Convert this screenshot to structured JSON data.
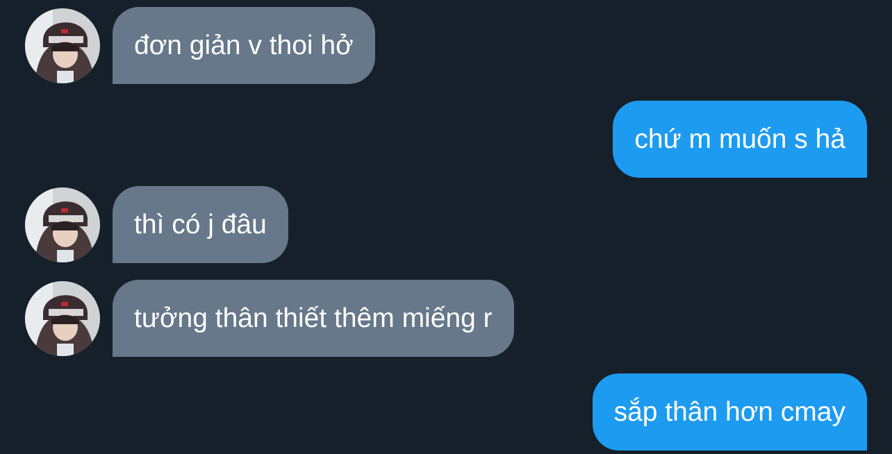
{
  "conversation": {
    "messages": [
      {
        "direction": "incoming",
        "text": "đơn giản v thoi hở",
        "avatar_icon": "user-avatar"
      },
      {
        "direction": "outgoing",
        "text": "chứ m muốn s hả"
      },
      {
        "direction": "incoming",
        "text": "thì có j đâu",
        "avatar_icon": "user-avatar"
      },
      {
        "direction": "incoming",
        "text": "tưởng thân thiết thêm miếng r",
        "avatar_icon": "user-avatar"
      },
      {
        "direction": "outgoing",
        "text": "sắp thân hơn cmay"
      }
    ]
  },
  "colors": {
    "background": "#16202a",
    "incoming_bubble": "#66788a",
    "outgoing_bubble": "#1d9bf0",
    "text": "#ffffff"
  }
}
